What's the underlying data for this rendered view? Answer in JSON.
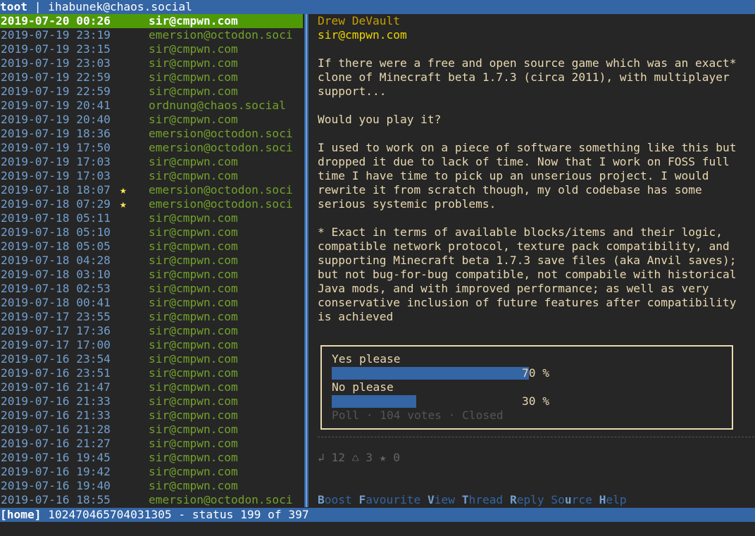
{
  "header": {
    "app": "toot",
    "sep": " | ",
    "user": "ihabunek@chaos.social"
  },
  "timeline": [
    {
      "dt": "2019-07-20 00:26",
      "star": "",
      "acct": "sir@cmpwn.com",
      "selected": true
    },
    {
      "dt": "2019-07-19 23:19",
      "star": "",
      "acct": "emersion@octodon.soci"
    },
    {
      "dt": "2019-07-19 23:15",
      "star": "",
      "acct": "sir@cmpwn.com"
    },
    {
      "dt": "2019-07-19 23:03",
      "star": "",
      "acct": "sir@cmpwn.com"
    },
    {
      "dt": "2019-07-19 22:59",
      "star": "",
      "acct": "sir@cmpwn.com"
    },
    {
      "dt": "2019-07-19 22:59",
      "star": "",
      "acct": "sir@cmpwn.com"
    },
    {
      "dt": "2019-07-19 20:41",
      "star": "",
      "acct": "ordnung@chaos.social"
    },
    {
      "dt": "2019-07-19 20:40",
      "star": "",
      "acct": "sir@cmpwn.com"
    },
    {
      "dt": "2019-07-19 18:36",
      "star": "",
      "acct": "emersion@octodon.soci"
    },
    {
      "dt": "2019-07-19 17:50",
      "star": "",
      "acct": "emersion@octodon.soci"
    },
    {
      "dt": "2019-07-19 17:03",
      "star": "",
      "acct": "sir@cmpwn.com"
    },
    {
      "dt": "2019-07-19 17:03",
      "star": "",
      "acct": "sir@cmpwn.com"
    },
    {
      "dt": "2019-07-18 18:07",
      "star": "★",
      "acct": "emersion@octodon.soci"
    },
    {
      "dt": "2019-07-18 07:29",
      "star": "★",
      "acct": "emersion@octodon.soci"
    },
    {
      "dt": "2019-07-18 05:11",
      "star": "",
      "acct": "sir@cmpwn.com"
    },
    {
      "dt": "2019-07-18 05:10",
      "star": "",
      "acct": "sir@cmpwn.com"
    },
    {
      "dt": "2019-07-18 05:05",
      "star": "",
      "acct": "sir@cmpwn.com"
    },
    {
      "dt": "2019-07-18 04:28",
      "star": "",
      "acct": "sir@cmpwn.com"
    },
    {
      "dt": "2019-07-18 03:10",
      "star": "",
      "acct": "sir@cmpwn.com"
    },
    {
      "dt": "2019-07-18 02:53",
      "star": "",
      "acct": "sir@cmpwn.com"
    },
    {
      "dt": "2019-07-18 00:41",
      "star": "",
      "acct": "sir@cmpwn.com"
    },
    {
      "dt": "2019-07-17 23:55",
      "star": "",
      "acct": "sir@cmpwn.com"
    },
    {
      "dt": "2019-07-17 17:36",
      "star": "",
      "acct": "sir@cmpwn.com"
    },
    {
      "dt": "2019-07-17 17:00",
      "star": "",
      "acct": "sir@cmpwn.com"
    },
    {
      "dt": "2019-07-16 23:54",
      "star": "",
      "acct": "sir@cmpwn.com"
    },
    {
      "dt": "2019-07-16 23:51",
      "star": "",
      "acct": "sir@cmpwn.com"
    },
    {
      "dt": "2019-07-16 21:47",
      "star": "",
      "acct": "sir@cmpwn.com"
    },
    {
      "dt": "2019-07-16 21:33",
      "star": "",
      "acct": "sir@cmpwn.com"
    },
    {
      "dt": "2019-07-16 21:33",
      "star": "",
      "acct": "sir@cmpwn.com"
    },
    {
      "dt": "2019-07-16 21:28",
      "star": "",
      "acct": "sir@cmpwn.com"
    },
    {
      "dt": "2019-07-16 21:27",
      "star": "",
      "acct": "sir@cmpwn.com"
    },
    {
      "dt": "2019-07-16 19:45",
      "star": "",
      "acct": "sir@cmpwn.com"
    },
    {
      "dt": "2019-07-16 19:42",
      "star": "",
      "acct": "sir@cmpwn.com"
    },
    {
      "dt": "2019-07-16 19:40",
      "star": "",
      "acct": "sir@cmpwn.com"
    },
    {
      "dt": "2019-07-16 18:55",
      "star": "",
      "acct": "emersion@octodon.soci"
    }
  ],
  "status": {
    "author_name": "Drew DeVault",
    "author_acct": "sir@cmpwn.com",
    "paragraphs": [
      "If there were a free and open source game which was an exact*\nclone of Minecraft beta 1.7.3 (circa 2011), with multiplayer\nsupport...",
      "Would you play it?",
      "I used to work on a piece of software something like this but\ndropped it due to lack of time. Now that I work on FOSS full\ntime I have time to pick up an unserious project. I would\nrewrite it from scratch though, my old codebase has some\nserious systemic problems.",
      "* Exact in terms of available blocks/items and their logic,\ncompatible network protocol, texture pack compatibility, and\nsupporting Minecraft beta 1.7.3 save files (aka Anvil saves);\nbut not bug-for-bug compatible, not compabile with historical\nJava mods, and with improved performance; as well as very\nconservative inclusion of future features after compatibility\nis achieved"
    ],
    "poll": {
      "options": [
        {
          "text": "Yes please",
          "percent": 70,
          "percent_label": "70 %"
        },
        {
          "text": "No please",
          "percent": 30,
          "percent_label": "30 %"
        }
      ],
      "meta": "Poll · 104 votes · Closed"
    },
    "stats": "↲ 12 ♺ 3 ★ 0",
    "actions": [
      {
        "key": "B",
        "rest": "oost"
      },
      {
        "pre": " ",
        "key": "F",
        "rest": "avourite"
      },
      {
        "pre": " ",
        "key": "V",
        "rest": "iew"
      },
      {
        "pre": " ",
        "key": "T",
        "rest": "hread"
      },
      {
        "pre": " ",
        "key": "R",
        "rest": "eply"
      },
      {
        "pre": " So",
        "key": "u",
        "rest": "rce"
      },
      {
        "pre": " ",
        "key": "H",
        "rest": "elp"
      }
    ]
  },
  "footer": {
    "timeline": "[home]",
    "status_id": " 102470465704031305",
    "position": " - status 199 of 397"
  },
  "colors": {
    "header_bg": "#3465a4",
    "selected_bg": "#4e9a06",
    "date": "#729fcf",
    "account": "#73a12b",
    "author": "#c4a000",
    "body": "#e9d9b0",
    "star": "#fce94f"
  }
}
